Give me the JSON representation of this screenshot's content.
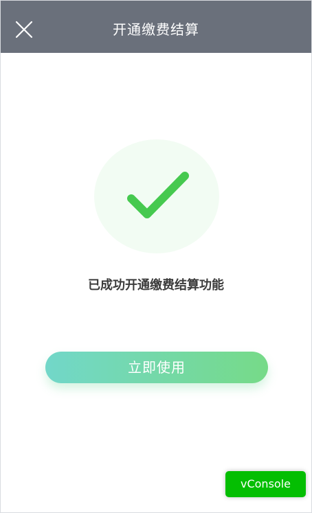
{
  "header": {
    "title": "开通缴费结算",
    "close_icon": "close-icon"
  },
  "success": {
    "icon": "checkmark-icon",
    "message": "已成功开通缴费结算功能"
  },
  "actions": {
    "use_now_label": "立即使用"
  },
  "debug": {
    "vconsole_label": "vConsole"
  },
  "colors": {
    "header_bg": "#6a707b",
    "success_green": "#46c94f",
    "button_gradient_start": "#72d7c9",
    "button_gradient_end": "#76da88",
    "vconsole_green": "#04be02"
  }
}
